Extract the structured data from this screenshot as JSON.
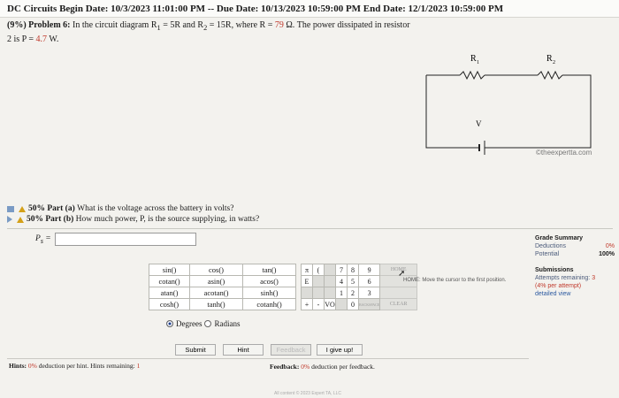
{
  "header": {
    "title": "DC Circuits",
    "begin_label": "Begin Date:",
    "begin": "10/3/2023 11:01:00 PM",
    "due_label": "-- Due Date:",
    "due": "10/13/2023 10:59:00 PM",
    "end_label": "End Date:",
    "end": "12/1/2023 10:59:00 PM"
  },
  "problem": {
    "weight": "(9%)",
    "number": "Problem 6:",
    "text_a": "In the circuit diagram R",
    "text_b": "= 5R and R",
    "text_c": "= 15R, where R =",
    "r_value": "79",
    "text_d": "Ω. The power dissipated in resistor 2 is P =",
    "p_value": "4.7",
    "p_unit": "W."
  },
  "circuit": {
    "r1_label": "R",
    "r1_sub": "1",
    "r2_label": "R",
    "r2_sub": "2",
    "v_label": "V",
    "watermark": "©theexpertta.com"
  },
  "parts": [
    {
      "weight": "50% Part (a)",
      "question": "What is the voltage across the battery in volts?"
    },
    {
      "weight": "50% Part (b)",
      "question": "How much power, P, is the source supplying, in watts?"
    }
  ],
  "answer": {
    "label": "P",
    "label_sub": "s",
    "equals": "=",
    "value": ""
  },
  "grade_summary": {
    "title": "Grade Summary",
    "deductions_label": "Deductions",
    "deductions_value": "0%",
    "potential_label": "Potential",
    "potential_value": "100%",
    "submissions_title": "Submissions",
    "attempts_label": "Attempts remaining:",
    "attempts_value": "3",
    "per_attempt": "(4% per attempt)",
    "detailed_view": "detailed view"
  },
  "calculator": {
    "functions": [
      [
        "sin()",
        "cos()",
        "tan()"
      ],
      [
        "cotan()",
        "asin()",
        "acos()"
      ],
      [
        "atan()",
        "acotan()",
        "sinh()"
      ],
      [
        "cosh()",
        "tanh()",
        "cotanh()"
      ]
    ],
    "symbols": [
      [
        "π",
        "("
      ],
      [
        "E",
        ""
      ],
      [
        "",
        ""
      ],
      [
        "+",
        "-"
      ]
    ],
    "keypad": [
      [
        "7",
        "8",
        "9"
      ],
      [
        "4",
        "5",
        "6"
      ],
      [
        "1",
        "2",
        "3"
      ],
      [
        "",
        "0",
        ""
      ]
    ],
    "side_keys": [
      "HOME",
      "",
      "",
      "END"
    ],
    "backspace": "BACKSPACE",
    "clear": "CLEAR",
    "vo": "VO",
    "degrees": "Degrees",
    "radians": "Radians",
    "home_hint": "HOME: Move the cursor to the first position."
  },
  "buttons": {
    "submit": "Submit",
    "hint": "Hint",
    "feedback": "Feedback",
    "give_up": "I give up!"
  },
  "hints": {
    "label": "Hints:",
    "deduction": "0%",
    "text": "deduction per hint. Hints remaining:",
    "remaining": "1"
  },
  "feedback": {
    "label": "Feedback:",
    "deduction": "0%",
    "text": "deduction per feedback."
  },
  "footer": {
    "text": "All content © 2023 Expert TA, LLC"
  },
  "colors": {
    "accent_red": "#c0392b",
    "link_blue": "#2c5aa0",
    "warning_yellow": "#d4a017"
  }
}
